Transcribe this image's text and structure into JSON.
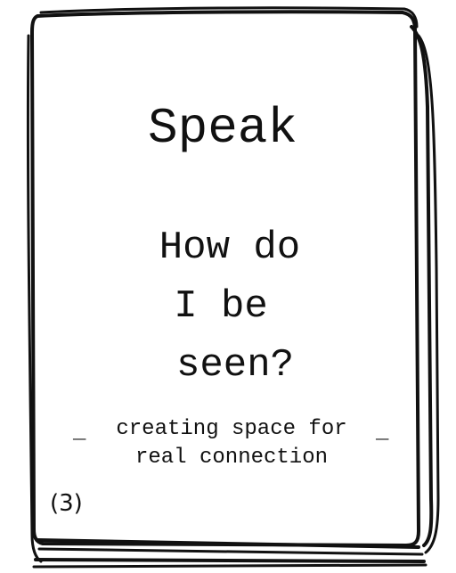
{
  "card": {
    "title": "Speak",
    "question_lines": [
      "How do",
      "I be",
      "seen?"
    ],
    "subtitle_lines": [
      "creating space for",
      "real connection"
    ],
    "number": "(3)"
  }
}
